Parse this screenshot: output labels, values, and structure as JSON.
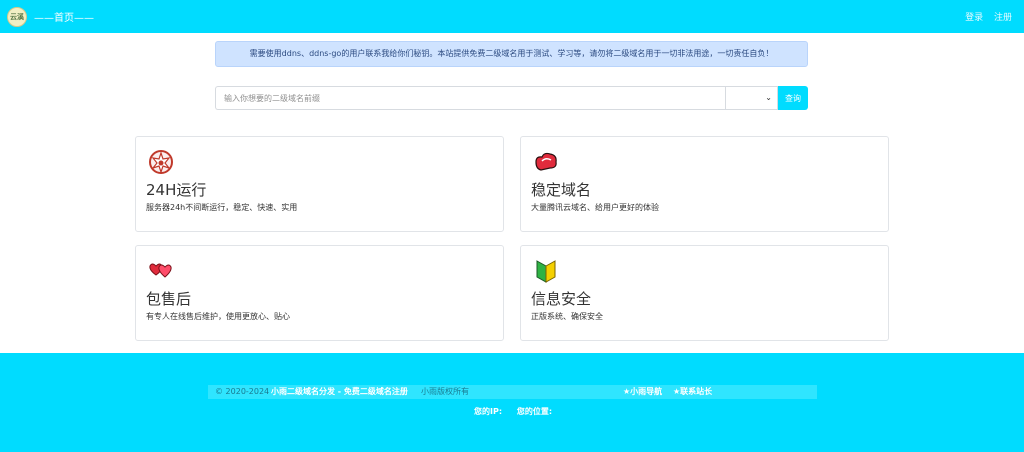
{
  "header": {
    "logo_text": "云溪",
    "brand": "——首页——",
    "login": "登录",
    "register": "注册"
  },
  "notice": {
    "text": "需要使用ddns、ddns-go的用户联系我给你们秘钥。本站提供免费二级域名用于测试、学习等，请勿将二级域名用于一切非法用途，一切责任自负！"
  },
  "search": {
    "placeholder": "输入你想要的二级域名前缀",
    "select_value": "",
    "button": "查询"
  },
  "cards": [
    {
      "title": "24H运行",
      "desc": "服务器24h不间断运行，稳定、快速、实用",
      "icon": "server-icon"
    },
    {
      "title": "稳定域名",
      "desc": "大量腾讯云域名、给用户更好的体验",
      "icon": "cloud-icon"
    },
    {
      "title": "包售后",
      "desc": "有专人在线售后维护，使用更放心、贴心",
      "icon": "hearts-icon"
    },
    {
      "title": "信息安全",
      "desc": "正版系统、确保安全",
      "icon": "shield-icon"
    }
  ],
  "footer": {
    "copyright": "© 2020-2024",
    "site_name": "小雨二级域名分发 - 免费二级域名注册",
    "rights": "小雨版权所有",
    "link1": "★小雨导航",
    "link2": "★联系站长",
    "ip_label": "您的IP:",
    "location_label": "您的位置:"
  },
  "colors": {
    "accent": "#00dcff",
    "notice_bg": "#cfe3ff"
  }
}
